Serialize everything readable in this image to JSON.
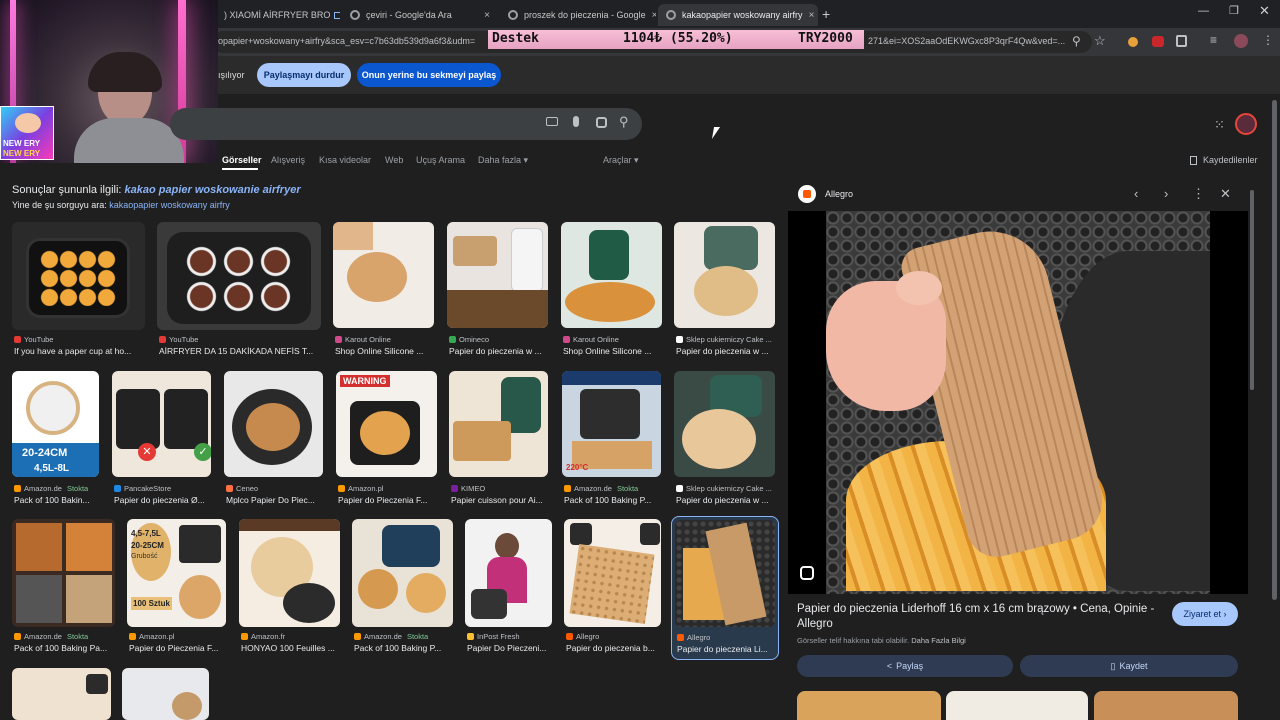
{
  "tabs": [
    {
      "title": ") XIAOMİ AİRFRYER BRO",
      "close": "×"
    },
    {
      "title": "çeviri - Google'da Ara",
      "close": "×"
    },
    {
      "title": "proszek do pieczenia - Google",
      "close": "×"
    },
    {
      "title": "kakaopapier woskowany airfry",
      "close": "×"
    }
  ],
  "new_tab": "+",
  "url_left": "opapier+woskowany+airfry&sca_esv=c7b63db539d9a6f3&udm=",
  "url_right": "271&ei=XOS2aaOdEKWGxc8P3qrF4Qw&ved=...",
  "ticker": {
    "label": "Destek",
    "amount": "1104₺ (55.20%)",
    "goal": "TRY2000"
  },
  "webcam": {
    "badge1": "NEW ERY",
    "badge2": "NEW ERY"
  },
  "sharebar": {
    "left_text": "ışılıyor",
    "stop": "Paylaşmayı durdur",
    "share_tab": "Onun yerine bu sekmeyi paylaş"
  },
  "nav": {
    "items": [
      "Görseller",
      "Alışveriş",
      "Kısa videolar",
      "Web",
      "Uçuş Arama",
      "Daha fazla ▾"
    ],
    "tools": "Araçlar ▾",
    "saved": "Kaydedilenler"
  },
  "results": {
    "related_prefix": "Sonuçlar şununla ilgili: ",
    "related_term": "kakao papier woskowanie airfryer",
    "again_prefix": "Yine de şu sorguyu ara: ",
    "again_term": "kakaopapier woskowany airfry"
  },
  "images": [
    {
      "source": "YouTube",
      "title": "If you have a paper cup at ho...",
      "stock": ""
    },
    {
      "source": "YouTube",
      "title": "AİRFRYER DA 15 DAKİKADA NEFİS T...",
      "stock": ""
    },
    {
      "source": "Karout Online",
      "title": "Shop Online Silicone ...",
      "stock": ""
    },
    {
      "source": "Omineco",
      "title": "Papier do pieczenia w ...",
      "stock": ""
    },
    {
      "source": "Karout Online",
      "title": "Shop Online Silicone ...",
      "stock": ""
    },
    {
      "source": "Sklep cukierniczy Cake ...",
      "title": "Papier do pieczenia w ...",
      "stock": ""
    },
    {
      "source": "Amazon.de",
      "title": "Pack of 100 Bakin...",
      "stock": "Stokta"
    },
    {
      "source": "PancakeStore",
      "title": "Papier do pieczenia Ø...",
      "stock": ""
    },
    {
      "source": "Ceneo",
      "title": "Mplco Papier Do Piec...",
      "stock": ""
    },
    {
      "source": "Amazon.pl",
      "title": "Papier do Pieczenia F...",
      "stock": ""
    },
    {
      "source": "KIMEO",
      "title": "Papier cuisson pour Ai...",
      "stock": ""
    },
    {
      "source": "Amazon.de",
      "title": "Pack of 100 Baking P...",
      "stock": "Stokta"
    },
    {
      "source": "Sklep cukierniczy Cake ...",
      "title": "Papier do pieczenia w ...",
      "stock": ""
    },
    {
      "source": "Amazon.de",
      "title": "Pack of 100 Baking Pa...",
      "stock": "Stokta"
    },
    {
      "source": "Amazon.pl",
      "title": "Papier do Pieczenia F...",
      "stock": ""
    },
    {
      "source": "Amazon.fr",
      "title": "HONYAO 100 Feuilles ...",
      "stock": ""
    },
    {
      "source": "Amazon.de",
      "title": "Pack of 100 Baking P...",
      "stock": "Stokta"
    },
    {
      "source": "InPost Fresh",
      "title": "Papier Do Pieczeni...",
      "stock": ""
    },
    {
      "source": "Allegro",
      "title": "Papier do pieczenia b...",
      "stock": ""
    },
    {
      "source": "Allegro",
      "title": "Papier do pieczenia Li...",
      "stock": ""
    }
  ],
  "thumb_text": {
    "size_main": "20-24CM",
    "size_sub": "4,5L-8L",
    "warning": "WARNING",
    "temp": "220°C",
    "size2a": "4,5-7,5L",
    "size2b": "20-25CM",
    "grubosc": "Grubość",
    "sztuk": "100 Sztuk"
  },
  "panel": {
    "site": "Allegro",
    "title": "Papier do pieczenia Liderhoff 16 cm x 16 cm brązowy • Cena, Opinie - Allegro",
    "visit": "Ziyaret et ›",
    "copyright": "Görseller telif hakkına tabi olabilir.",
    "more_info": "Daha Fazla Bilgi",
    "share": "Paylaş",
    "save": "Kaydet"
  }
}
